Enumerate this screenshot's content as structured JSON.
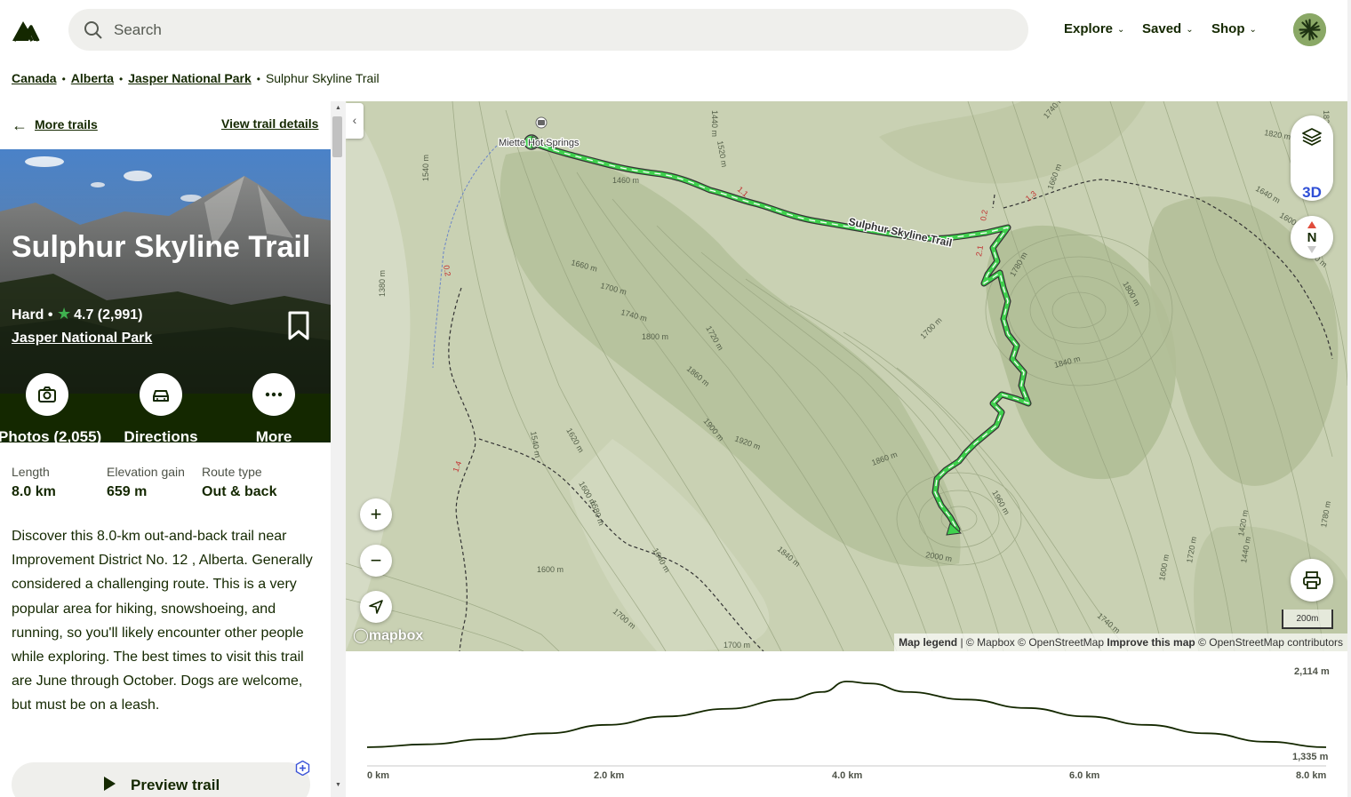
{
  "header": {
    "search_placeholder": "Search",
    "nav": [
      {
        "label": "Explore"
      },
      {
        "label": "Saved"
      },
      {
        "label": "Shop"
      }
    ]
  },
  "breadcrumb": {
    "items": [
      "Canada",
      "Alberta",
      "Jasper National Park"
    ],
    "current": "Sulphur Skyline Trail"
  },
  "panel": {
    "more_trails": "More trails",
    "view_details": "View trail details",
    "title": "Sulphur Skyline Trail",
    "difficulty": "Hard",
    "rating": "4.7",
    "reviews": "(2,991)",
    "park": "Jasper National Park",
    "actions": [
      {
        "label": "Photos (2,055)",
        "icon": "camera-icon"
      },
      {
        "label": "Directions",
        "icon": "car-icon"
      },
      {
        "label": "More",
        "icon": "ellipsis-icon"
      }
    ],
    "stats": [
      {
        "key": "Length",
        "value": "8.0 km"
      },
      {
        "key": "Elevation gain",
        "value": "659 m"
      },
      {
        "key": "Route type",
        "value": "Out & back"
      }
    ],
    "description": "Discover this 8.0-km out-and-back trail near Improvement District No. 12 , Alberta. Generally considered a challenging route. This is a very popular area for hiking, snowshoeing, and running, so you'll likely encounter other people while exploring. The best times to visit this trail are June through October. Dogs are welcome, but must be on a leash.",
    "preview_label": "Preview trail"
  },
  "map": {
    "trail_label": "Sulphur Skyline Trail",
    "poi_label": "Miette Hot Springs",
    "btn_3d": "3D",
    "compass": "N",
    "scale": "200m",
    "logo": "mapbox",
    "attribution": {
      "legend": "Map legend",
      "mapbox": "| © Mapbox © OpenStreetMap",
      "improve": "Improve this map",
      "osm": "© OpenStreetMap contributors"
    },
    "contour_labels": [
      "1460 m",
      "1660 m",
      "1700 m",
      "1740 m",
      "1800 m",
      "1720 m",
      "1860 m",
      "1900 m",
      "1920 m",
      "1860 m",
      "1960 m",
      "2000 m",
      "1840 m",
      "1700 m",
      "1780 m",
      "1620 m",
      "1600 m",
      "1640 m",
      "1700 m",
      "1540 m",
      "1580 m",
      "1520 m",
      "1440 m",
      "1540 m",
      "1380 m",
      "1820 m",
      "1640 m",
      "1600 m",
      "1620 m",
      "1800 m",
      "1660 m",
      "1740 m",
      "1820 m",
      "1420 m",
      "1440 m",
      "1600 m",
      "1720 m",
      "1780 m",
      "1840 m",
      "1600 m",
      "1700 m",
      "1740 m"
    ],
    "segment_labels": [
      "1.1",
      "1.3",
      "0.2",
      "2.1",
      "0.2",
      "1.4"
    ]
  },
  "elevation": {
    "max_label": "2,114 m",
    "min_label": "1,335 m",
    "x_ticks": [
      "0 km",
      "2.0 km",
      "4.0 km",
      "6.0 km",
      "8.0 km"
    ],
    "chart_data": {
      "type": "area",
      "x": [
        0,
        0.5,
        1.0,
        1.5,
        2.0,
        2.5,
        3.0,
        3.5,
        3.8,
        4.0,
        4.2,
        4.5,
        5.0,
        5.5,
        6.0,
        6.5,
        7.0,
        7.5,
        8.0
      ],
      "y": [
        1335,
        1370,
        1430,
        1500,
        1600,
        1700,
        1790,
        1900,
        1990,
        2114,
        2090,
        1990,
        1900,
        1800,
        1700,
        1600,
        1500,
        1400,
        1335
      ],
      "xlabel": "",
      "ylabel": "",
      "ylim": [
        1335,
        2114
      ],
      "xlim": [
        0,
        8
      ]
    }
  },
  "colors": {
    "brand": "#142800",
    "trail": "#3fd14d",
    "map_bg": "#c5ceb0",
    "accent_3d": "#2f4fd6"
  }
}
